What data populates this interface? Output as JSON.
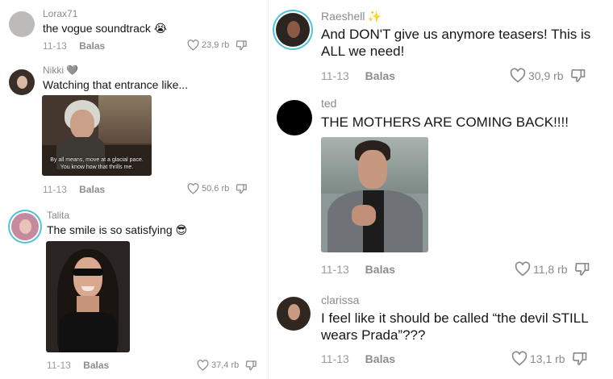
{
  "comments_left": [
    {
      "username": "Lorax71",
      "text": "the vogue soundtrack 😭",
      "date": "11-13",
      "reply_label": "Balas",
      "likes": "23,9 rb"
    },
    {
      "username": "Nikki",
      "username_emoji": "🩶",
      "text": "Watching that entrance like...",
      "date": "11-13",
      "reply_label": "Balas",
      "likes": "50,6 rb",
      "media_caption": "By all means, move at a glacial pace. You know how that thrills me."
    },
    {
      "username": "Talita",
      "text": "The smile is so satisfying 😎",
      "date": "11-13",
      "reply_label": "Balas",
      "likes": "37,4 rb"
    }
  ],
  "comments_right": [
    {
      "username": "Raeshell",
      "username_emoji": "✨",
      "text": "And DON'T give us anymore teasers! This is ALL we need!",
      "date": "11-13",
      "reply_label": "Balas",
      "likes": "30,9 rb"
    },
    {
      "username": "ted",
      "text": "THE MOTHERS ARE COMING BACK!!!!",
      "date": "11-13",
      "reply_label": "Balas",
      "likes": "11,8 rb"
    },
    {
      "username": "clarissa",
      "text": "I feel like it should be called “the devil STILL wears Prada”???",
      "date": "11-13",
      "reply_label": "Balas",
      "likes": "13,1 rb"
    }
  ],
  "icons": {
    "like": "heart-outline-icon",
    "dislike": "thumbs-down-outline-icon"
  },
  "colors": {
    "username": "#8a8a8a",
    "text": "#161616",
    "meta": "#9b9b9b",
    "story_ring": "#4fc3dc"
  }
}
